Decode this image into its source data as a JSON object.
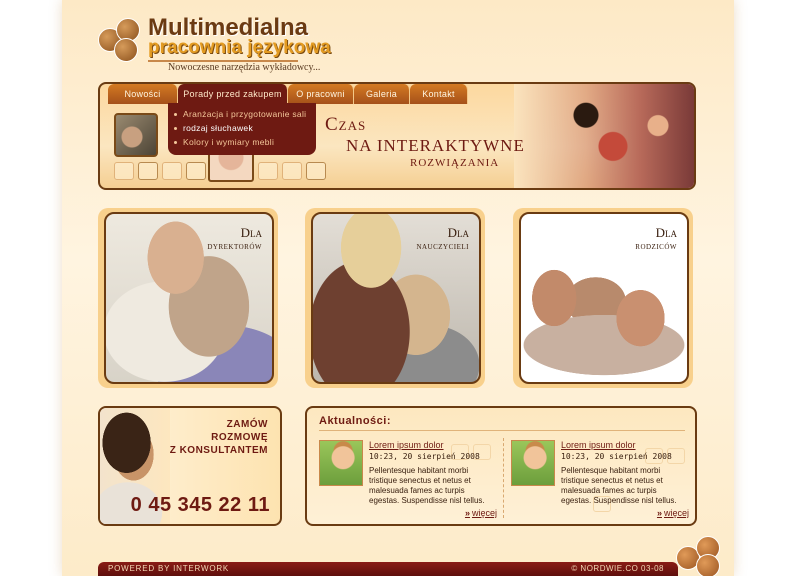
{
  "logo": {
    "title_line1": "Multimedialna",
    "title_line2": "pracownia językowa",
    "tagline": "Nowoczesne narzędzia wykładowcy..."
  },
  "nav": {
    "tabs": [
      {
        "label": "Nowości"
      },
      {
        "label": "Porady przed zakupem"
      },
      {
        "label": "O pracowni"
      },
      {
        "label": "Galeria"
      },
      {
        "label": "Kontakt"
      }
    ],
    "submenu": [
      {
        "label": "Aranżacja i przygotowanie sali"
      },
      {
        "label": "rodzaj słuchawek"
      },
      {
        "label": "Kolory i wymiary mebli"
      }
    ]
  },
  "banner": {
    "line1": "Czas",
    "line2": "na interaktywne",
    "line3": "rozwiązania"
  },
  "cards": [
    {
      "line1": "Dla",
      "line2": "dyrektorów"
    },
    {
      "line1": "Dla",
      "line2": "nauczycieli"
    },
    {
      "line1": "Dla",
      "line2": "rodziców"
    }
  ],
  "consult": {
    "line1": "ZAMÓW",
    "line2": "ROZMOWĘ",
    "line3": "Z KONSULTANTEM",
    "phone": "0 45 345 22 11"
  },
  "news": {
    "title": "Aktualności:",
    "items": [
      {
        "headline": "Lorem ipsum dolor",
        "date": "10:23, 20 sierpień 2008",
        "body": "Pellentesque habitant morbi tristique senectus et netus et malesuada fames ac turpis egestas. Suspendisse nisl tellus.",
        "more": "więcej"
      },
      {
        "headline": "Lorem ipsum dolor",
        "date": "10:23, 20 sierpień 2008",
        "body": "Pellentesque habitant morbi tristique senectus et netus et malesuada fames ac turpis egestas. Suspendisse nisl tellus.",
        "more": "więcej"
      }
    ]
  },
  "footer": {
    "left": "POWERED BY INTERWORK",
    "right": "© NORDWIE.CO 03-08"
  }
}
